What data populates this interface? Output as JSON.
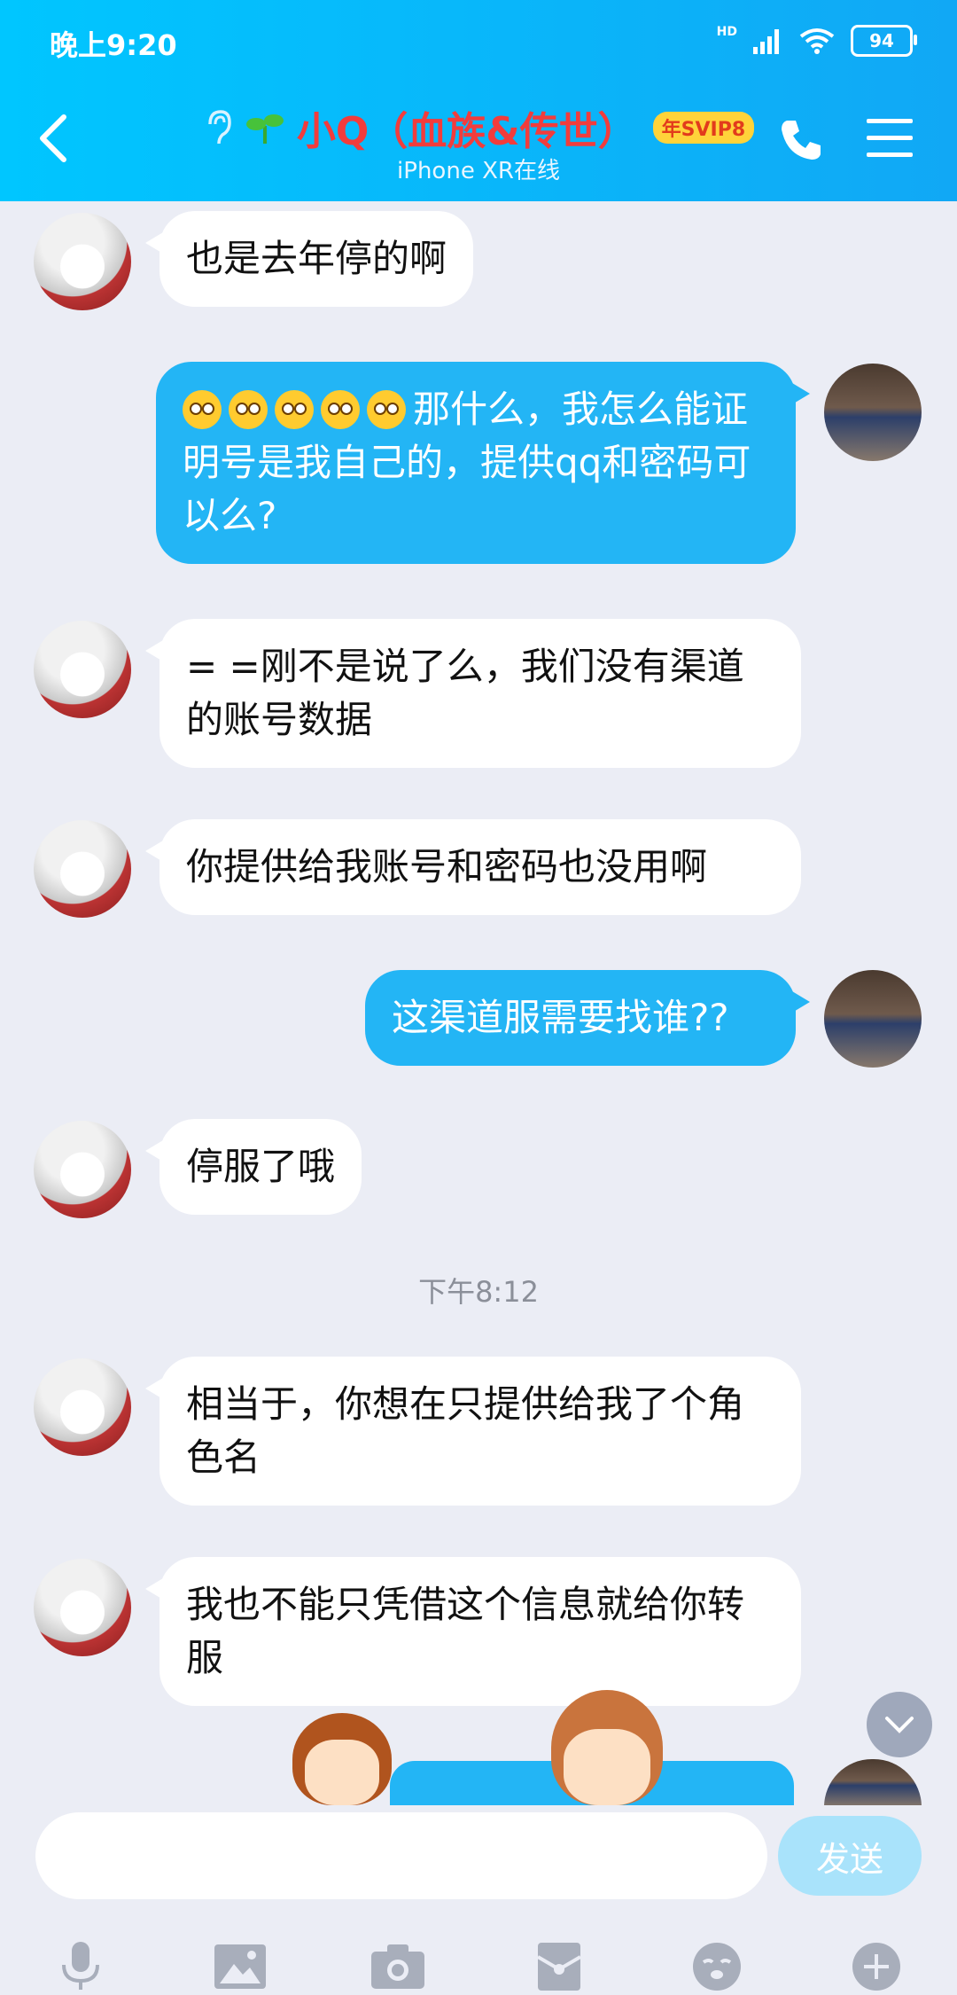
{
  "status_bar": {
    "time": "晚上9:20",
    "battery": "94",
    "network": "HD"
  },
  "header": {
    "contact_name": "小Q（血族&传世）",
    "badge": "年SVIP8",
    "subtitle": "iPhone XR在线"
  },
  "messages": [
    {
      "from": "them",
      "text": "也是去年停的啊"
    },
    {
      "from": "me",
      "text": "那什么，我怎么能证明号是我自己的，提供qq和密码可以么?"
    },
    {
      "from": "them",
      "text": "= =刚不是说了么，我们没有渠道的账号数据"
    },
    {
      "from": "them",
      "text": "你提供给我账号和密码也没用啊"
    },
    {
      "from": "me",
      "text": "这渠道服需要找谁??"
    },
    {
      "from": "them",
      "text": "停服了哦"
    },
    {
      "from": "them",
      "text": "相当于，你想在只提供给我了个角色名"
    },
    {
      "from": "them",
      "text": "我也不能只凭借这个信息就给你转服"
    }
  ],
  "timestamp": "下午8:12",
  "input": {
    "placeholder": "",
    "send_label": "发送"
  },
  "toolbar": {
    "icons": [
      "mic-icon",
      "image-icon",
      "camera-icon",
      "red-packet-icon",
      "emoji-icon",
      "plus-icon"
    ]
  },
  "colors": {
    "header": "#11a8f5",
    "outgoing_bubble": "#23b5f5",
    "background": "#ebedf5"
  }
}
